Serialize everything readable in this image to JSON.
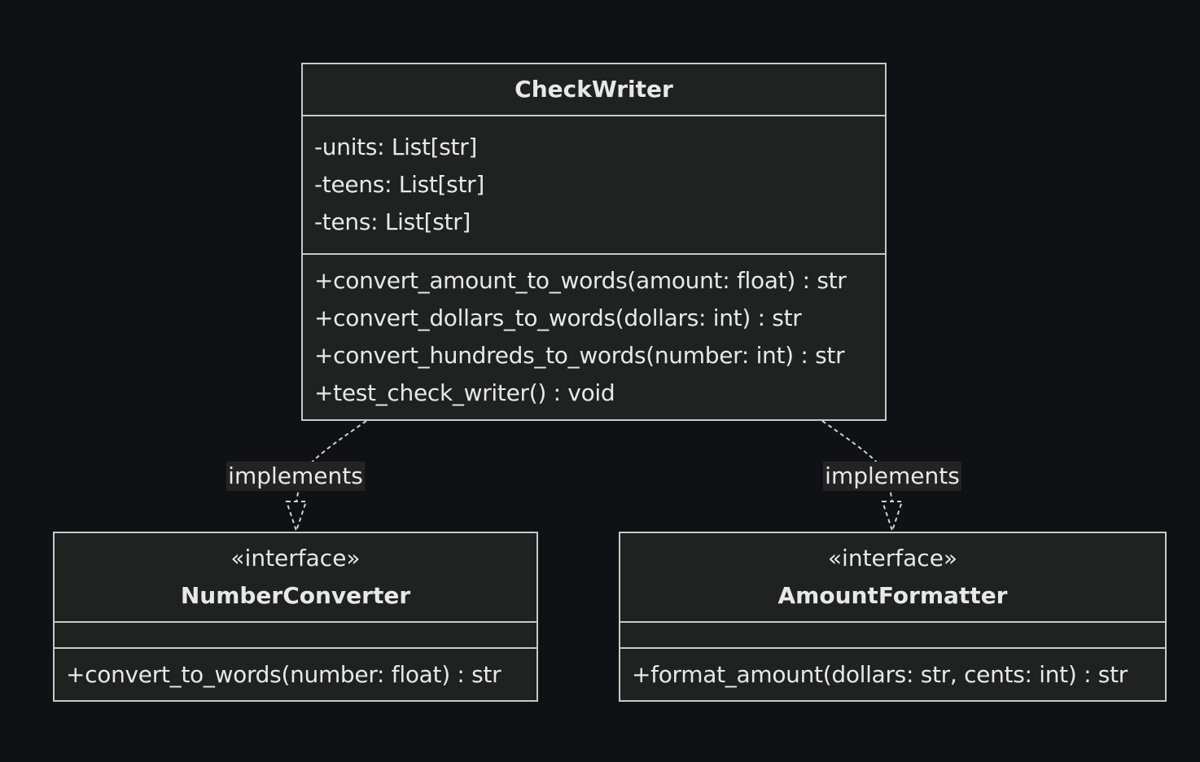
{
  "diagram": {
    "classes": {
      "check_writer": {
        "name": "CheckWriter",
        "attributes": [
          "-units: List[str]",
          "-teens: List[str]",
          "-tens: List[str]"
        ],
        "methods": [
          "+convert_amount_to_words(amount: float) : str",
          "+convert_dollars_to_words(dollars: int) : str",
          "+convert_hundreds_to_words(number: int) : str",
          "+test_check_writer() : void"
        ]
      },
      "number_converter": {
        "stereotype": "«interface»",
        "name": "NumberConverter",
        "methods": [
          "+convert_to_words(number: float) : str"
        ]
      },
      "amount_formatter": {
        "stereotype": "«interface»",
        "name": "AmountFormatter",
        "methods": [
          "+format_amount(dollars: str, cents: int) : str"
        ]
      }
    },
    "relations": [
      {
        "from": "CheckWriter",
        "to": "NumberConverter",
        "type": "realization",
        "label": "implements"
      },
      {
        "from": "CheckWriter",
        "to": "AmountFormatter",
        "type": "realization",
        "label": "implements"
      }
    ],
    "colors": {
      "background": "#0f1114",
      "box_fill": "#202121",
      "box_border": "#c8c8c8",
      "text": "#e8e8e8",
      "edge_line": "#d0d0d0",
      "label_background": "#232323"
    }
  }
}
